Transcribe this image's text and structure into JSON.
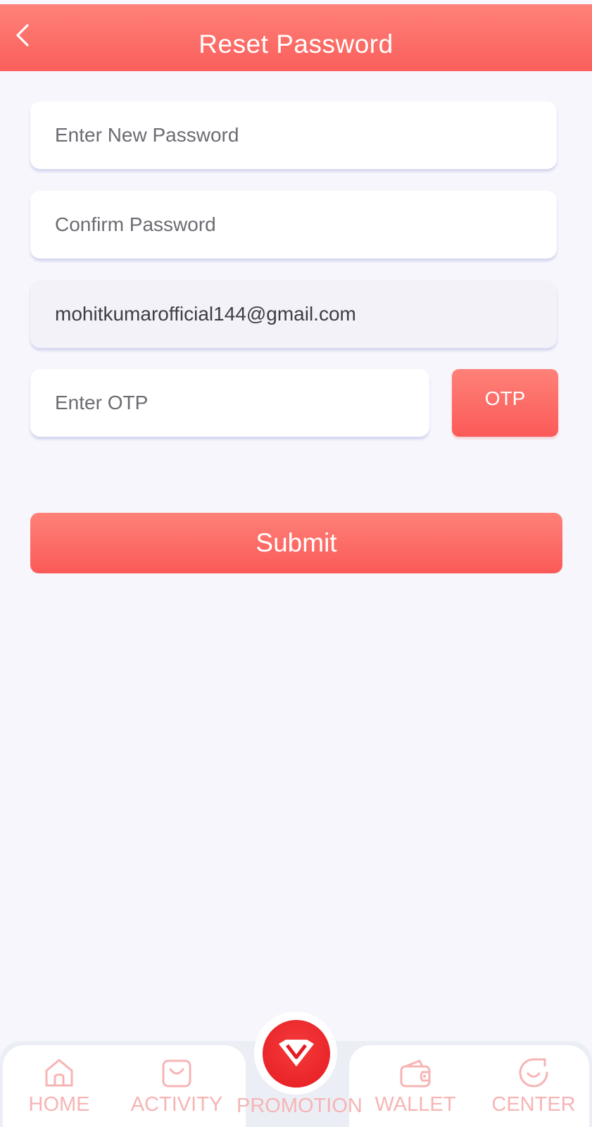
{
  "header": {
    "title": "Reset Password"
  },
  "form": {
    "new_password_placeholder": "Enter New Password",
    "confirm_password_placeholder": "Confirm Password",
    "email_value": "mohitkumarofficial144@gmail.com",
    "otp_placeholder": "Enter OTP",
    "otp_button_label": "OTP",
    "submit_label": "Submit"
  },
  "nav": {
    "home": "HOME",
    "activity": "ACTIVITY",
    "promotion": "PROMOTION",
    "wallet": "WALLET",
    "center": "CENTER"
  },
  "colors": {
    "accent": "#fb5f5c",
    "accent_light": "#fe8178",
    "background": "#f6f6fc",
    "nav_label": "#f7b4b4"
  },
  "icons": {
    "back": "chevron-left-icon",
    "home": "home-icon",
    "activity": "shopping-bag-icon",
    "promotion": "diamond-logo-icon",
    "wallet": "wallet-icon",
    "center": "smile-face-icon"
  }
}
